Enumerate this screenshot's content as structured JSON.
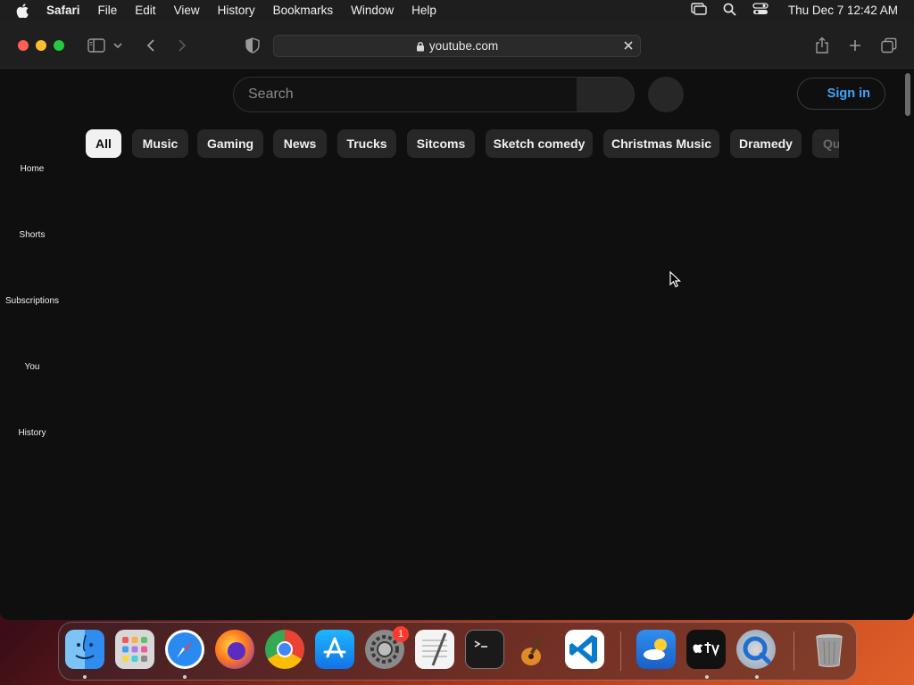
{
  "menubar": {
    "app_name": "Safari",
    "items": [
      "File",
      "Edit",
      "View",
      "History",
      "Bookmarks",
      "Window",
      "Help"
    ],
    "clock": "Thu Dec 7  12:42 AM"
  },
  "browser": {
    "address": "youtube.com"
  },
  "youtube": {
    "search_placeholder": "Search",
    "sign_in": "Sign in",
    "chips": [
      "All",
      "Music",
      "Gaming",
      "News",
      "Trucks",
      "Sitcoms",
      "Sketch comedy",
      "Christmas Music",
      "Dramedy",
      "Qu"
    ],
    "active_chip": "All",
    "sidebar": [
      "Home",
      "Shorts",
      "Subscriptions",
      "You",
      "History"
    ]
  },
  "dock": {
    "apps": [
      "finder-icon",
      "launchpad-icon",
      "safari-icon",
      "firefox-icon",
      "chrome-icon",
      "app-store-icon",
      "system-settings-icon",
      "textedit-icon",
      "terminal-icon",
      "garageband-icon",
      "vscode-icon",
      "weather-icon",
      "apple-tv-icon",
      "quicktime-icon",
      "trash-icon"
    ],
    "settings_badge": "1"
  },
  "colors": {
    "youtube_bg": "#0f0f0f",
    "chip_bg": "#272727",
    "chip_active_bg": "#f1f1f1",
    "signin_blue": "#3ea6ff"
  }
}
